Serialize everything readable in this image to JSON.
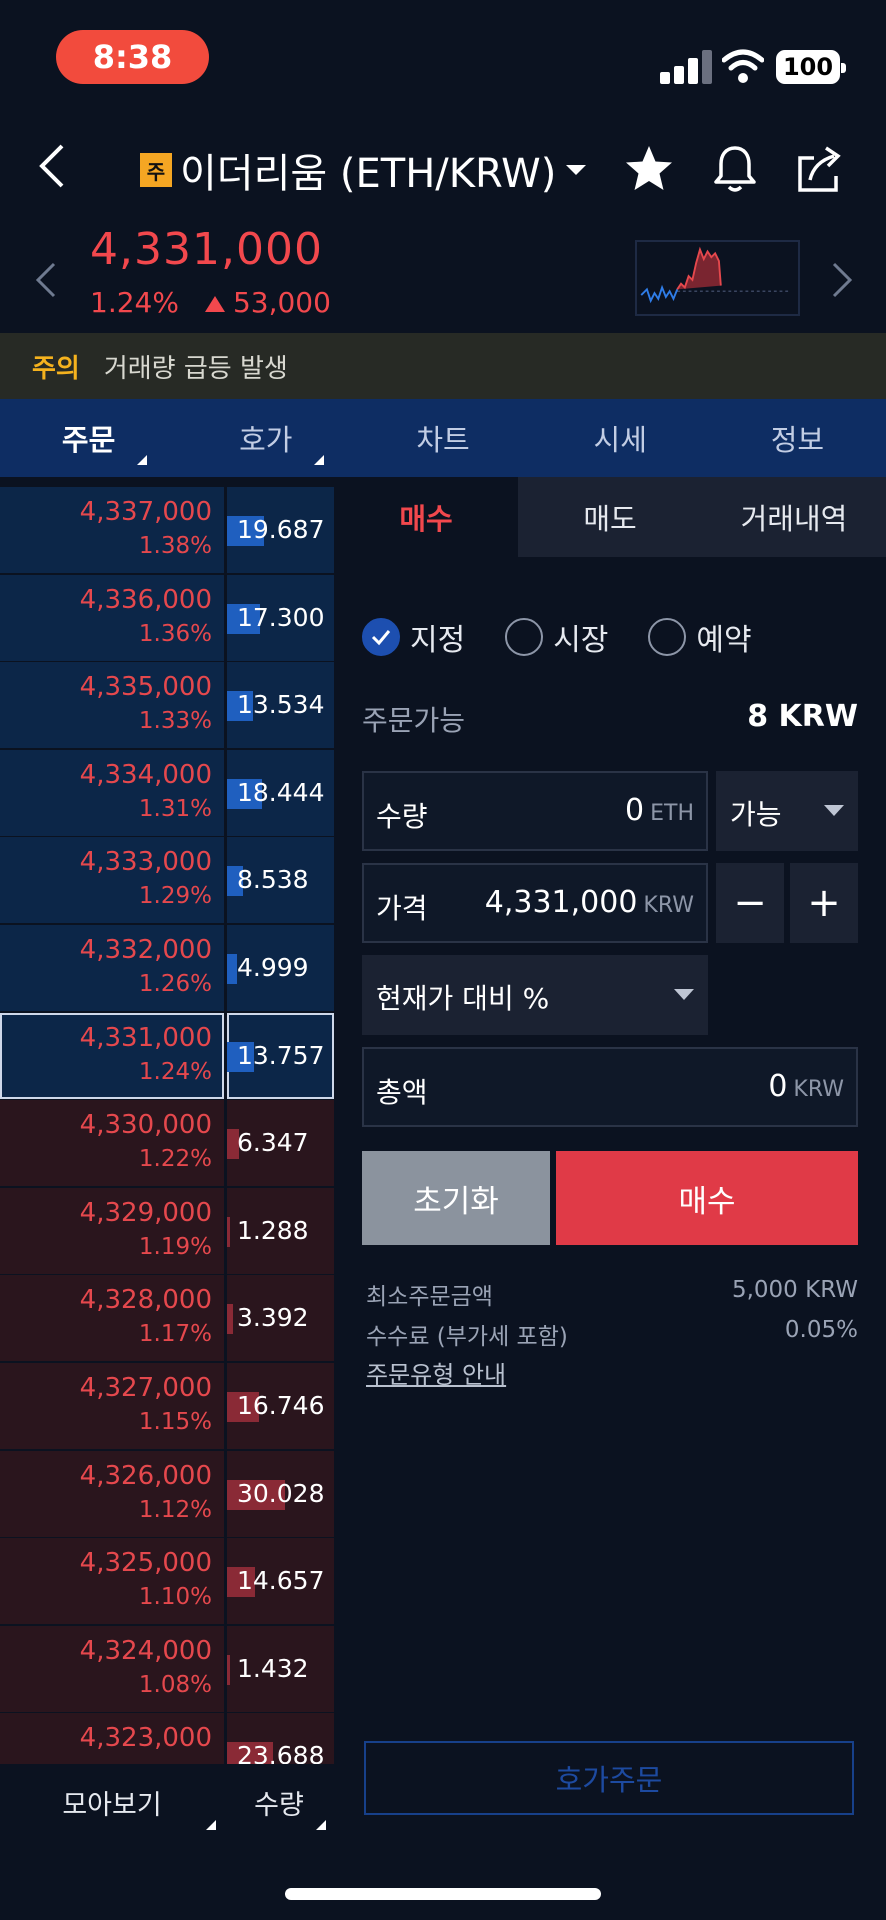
{
  "status": {
    "time": "8:38",
    "battery": "100"
  },
  "header": {
    "coin_badge": "주",
    "title": "이더리움 (ETH/KRW)"
  },
  "ticker": {
    "price": "4,331,000",
    "change_pct": "1.24%",
    "change_amount": "53,000",
    "up_color": "#f2484d"
  },
  "warning": {
    "label": "주의",
    "text": "거래량 급등 발생"
  },
  "tabs": [
    {
      "label": "주문",
      "active": true,
      "corner": true
    },
    {
      "label": "호가",
      "active": false,
      "corner": true
    },
    {
      "label": "차트",
      "active": false,
      "corner": false
    },
    {
      "label": "시세",
      "active": false,
      "corner": false
    },
    {
      "label": "정보",
      "active": false,
      "corner": false
    }
  ],
  "orderbook": {
    "rows": [
      {
        "price": "4,337,000",
        "pct": "1.38%",
        "qty": "19.687",
        "side": "ask",
        "fill": 0.35
      },
      {
        "price": "4,336,000",
        "pct": "1.36%",
        "qty": "17.300",
        "side": "ask",
        "fill": 0.31
      },
      {
        "price": "4,335,000",
        "pct": "1.33%",
        "qty": "13.534",
        "side": "ask",
        "fill": 0.24
      },
      {
        "price": "4,334,000",
        "pct": "1.31%",
        "qty": "18.444",
        "side": "ask",
        "fill": 0.33
      },
      {
        "price": "4,333,000",
        "pct": "1.29%",
        "qty": "8.538",
        "side": "ask",
        "fill": 0.15
      },
      {
        "price": "4,332,000",
        "pct": "1.26%",
        "qty": "4.999",
        "side": "ask",
        "fill": 0.09
      },
      {
        "price": "4,331,000",
        "pct": "1.24%",
        "qty": "13.757",
        "side": "ask",
        "fill": 0.25,
        "current": true
      },
      {
        "price": "4,330,000",
        "pct": "1.22%",
        "qty": "6.347",
        "side": "bid",
        "fill": 0.11
      },
      {
        "price": "4,329,000",
        "pct": "1.19%",
        "qty": "1.288",
        "side": "bid",
        "fill": 0.03
      },
      {
        "price": "4,328,000",
        "pct": "1.17%",
        "qty": "3.392",
        "side": "bid",
        "fill": 0.06
      },
      {
        "price": "4,327,000",
        "pct": "1.15%",
        "qty": "16.746",
        "side": "bid",
        "fill": 0.3
      },
      {
        "price": "4,326,000",
        "pct": "1.12%",
        "qty": "30.028",
        "side": "bid",
        "fill": 0.54
      },
      {
        "price": "4,325,000",
        "pct": "1.10%",
        "qty": "14.657",
        "side": "bid",
        "fill": 0.26
      },
      {
        "price": "4,324,000",
        "pct": "1.08%",
        "qty": "1.432",
        "side": "bid",
        "fill": 0.03
      },
      {
        "price": "4,323,000",
        "pct": "",
        "qty": "23.688",
        "side": "bid",
        "fill": 0.43
      }
    ],
    "footer": {
      "group_label": "모아보기",
      "qty_label": "수량"
    }
  },
  "order": {
    "tabs": [
      {
        "label": "매수",
        "active": true
      },
      {
        "label": "매도",
        "active": false
      },
      {
        "label": "거래내역",
        "active": false
      }
    ],
    "types": [
      {
        "label": "지정",
        "checked": true
      },
      {
        "label": "시장",
        "checked": false
      },
      {
        "label": "예약",
        "checked": false
      }
    ],
    "available_label": "주문가능",
    "available_value": "8 KRW",
    "qty": {
      "label": "수량",
      "value": "0",
      "unit": "ETH",
      "option": "가능"
    },
    "price": {
      "label": "가격",
      "value": "4,331,000",
      "unit": "KRW",
      "minus": "−",
      "plus": "+"
    },
    "ratio_select": "현재가 대비 %",
    "total": {
      "label": "총액",
      "value": "0",
      "unit": "KRW"
    },
    "reset_label": "초기화",
    "buy_label": "매수",
    "info": [
      {
        "label": "최소주문금액",
        "value": "5,000 KRW"
      },
      {
        "label": "수수료 (부가세 포함)",
        "value": "0.05%"
      }
    ],
    "guide_link": "주문유형 안내",
    "hoga_order": "호가주문"
  }
}
